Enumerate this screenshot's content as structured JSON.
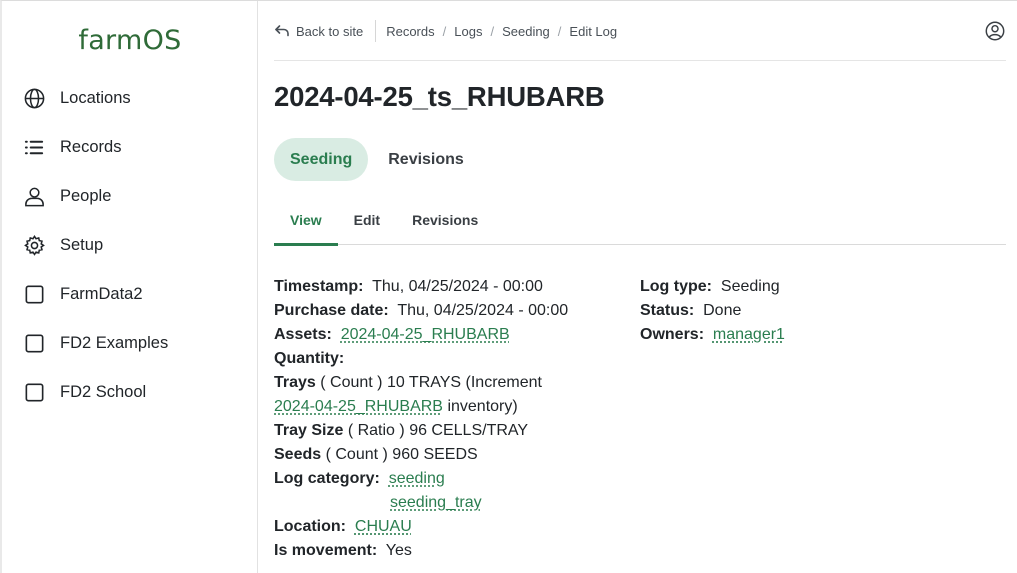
{
  "app": {
    "logo": "farmOS"
  },
  "sidebar": {
    "items": [
      {
        "label": "Locations",
        "icon": "globe-icon"
      },
      {
        "label": "Records",
        "icon": "list-icon"
      },
      {
        "label": "People",
        "icon": "person-icon"
      },
      {
        "label": "Setup",
        "icon": "gear-icon"
      },
      {
        "label": "FarmData2",
        "icon": "square-icon"
      },
      {
        "label": "FD2 Examples",
        "icon": "square-icon"
      },
      {
        "label": "FD2 School",
        "icon": "square-icon"
      }
    ]
  },
  "topbar": {
    "back_label": "Back to site",
    "breadcrumbs": [
      "Records",
      "Logs",
      "Seeding",
      "Edit Log"
    ],
    "separator": "/"
  },
  "page": {
    "title": "2024-04-25_ts_RHUBARB",
    "primary_tabs": [
      "Seeding",
      "Revisions"
    ],
    "secondary_tabs": [
      "View",
      "Edit",
      "Revisions"
    ]
  },
  "fields": {
    "timestamp_label": "Timestamp:",
    "timestamp_value": "Thu, 04/25/2024 - 00:00",
    "purchase_label": "Purchase date:",
    "purchase_value": "Thu, 04/25/2024 - 00:00",
    "assets_label": "Assets:",
    "assets_value": "2024-04-25_RHUBARB",
    "quantity_label": "Quantity:",
    "trays_label": "Trays",
    "trays_measure": "( Count )",
    "trays_value": "10 TRAYS (Increment",
    "trays_asset": "2024-04-25_RHUBARB",
    "trays_suffix": "inventory)",
    "traysize_label": "Tray Size",
    "traysize_measure": "( Ratio )",
    "traysize_value": "96 CELLS/TRAY",
    "seeds_label": "Seeds",
    "seeds_measure": "( Count )",
    "seeds_value": "960 SEEDS",
    "category_label": "Log category:",
    "categories": [
      "seeding",
      "seeding_tray"
    ],
    "location_label": "Location:",
    "location_value": "CHUAU",
    "movement_label": "Is movement:",
    "movement_value": "Yes",
    "logtype_label": "Log type:",
    "logtype_value": "Seeding",
    "status_label": "Status:",
    "status_value": "Done",
    "owners_label": "Owners:",
    "owners_value": "manager1"
  },
  "colors": {
    "accent": "#2a7d4f",
    "active_tab_bg": "#d9ece3",
    "logo": "#2f6b38"
  }
}
